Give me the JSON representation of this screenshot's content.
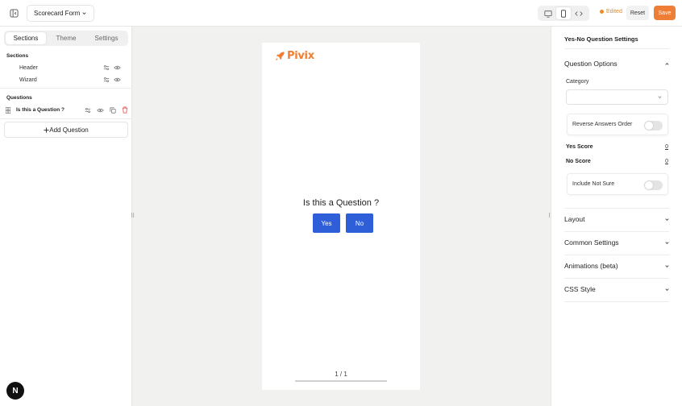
{
  "header": {
    "form_title": "Scorecard Form",
    "edited_label": "Edited",
    "reset_label": "Reset",
    "save_label": "Save",
    "accent": "#ee7d35"
  },
  "left": {
    "tabs": [
      {
        "label": "Sections",
        "active": true
      },
      {
        "label": "Theme",
        "active": false
      },
      {
        "label": "Settings",
        "active": false
      }
    ],
    "sections_heading": "Sections",
    "sections": [
      {
        "label": "Header"
      },
      {
        "label": "Wizard"
      }
    ],
    "questions_heading": "Questions",
    "questions": [
      {
        "label": "Is this a Question ?"
      }
    ],
    "add_question_label": "Add Question",
    "badge_letter": "N"
  },
  "preview": {
    "logo_text": "Pivix",
    "question": "Is this a Question ?",
    "answers": [
      "Yes",
      "No"
    ],
    "answer_color": "#2f5fd8",
    "pager": "1 / 1",
    "progress": 1.0
  },
  "right": {
    "title": "Yes-No Question Settings",
    "question_options": "Question Options",
    "category_label": "Category",
    "category_value": "",
    "reverse_label": "Reverse Answers Order",
    "reverse_on": false,
    "yes_score_label": "Yes Score",
    "yes_score": "0",
    "no_score_label": "No Score",
    "no_score": "0",
    "not_sure_label": "Include Not Sure",
    "not_sure_on": false,
    "accordions": [
      "Layout",
      "Common Settings",
      "Animations (beta)",
      "CSS Style"
    ]
  }
}
